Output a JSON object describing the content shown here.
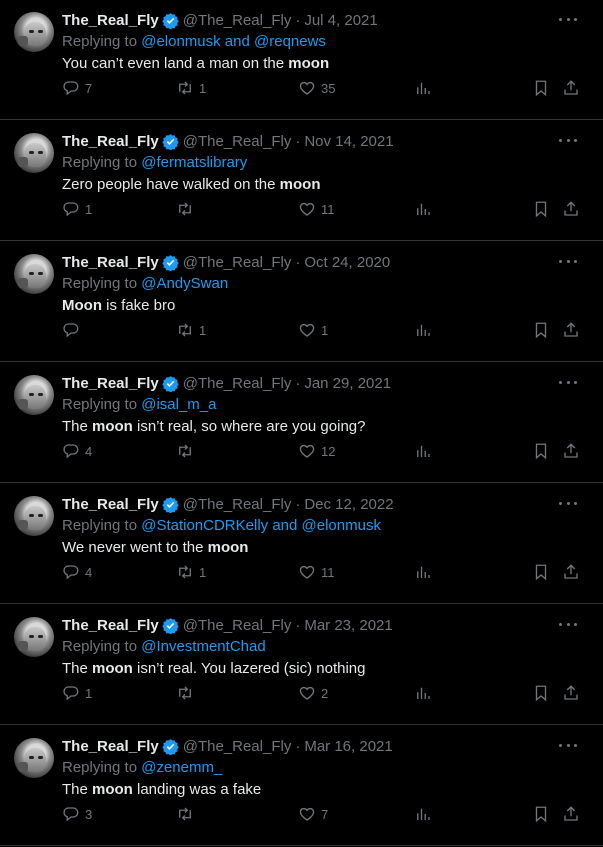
{
  "tweets": [
    {
      "name": "The_Real_Fly",
      "handle": "@The_Real_Fly",
      "date": "Jul 4, 2021",
      "replying_prefix": "Replying to ",
      "replying_to": "@elonmusk and @reqnews",
      "text_before": "You can’t even land a man on the ",
      "bold": "moon",
      "text_after": "",
      "replies": "7",
      "retweets": "1",
      "likes": "35"
    },
    {
      "name": "The_Real_Fly",
      "handle": "@The_Real_Fly",
      "date": "Nov 14, 2021",
      "replying_prefix": "Replying to ",
      "replying_to": "@fermatslibrary",
      "text_before": "Zero people have walked on the ",
      "bold": "moon",
      "text_after": "",
      "replies": "1",
      "retweets": "",
      "likes": "11"
    },
    {
      "name": "The_Real_Fly",
      "handle": "@The_Real_Fly",
      "date": "Oct 24, 2020",
      "replying_prefix": "Replying to ",
      "replying_to": "@AndySwan",
      "text_before": "",
      "bold": "Moon",
      "text_after": " is fake bro",
      "replies": "",
      "retweets": "1",
      "likes": "1"
    },
    {
      "name": "The_Real_Fly",
      "handle": "@The_Real_Fly",
      "date": "Jan 29, 2021",
      "replying_prefix": "Replying to ",
      "replying_to": "@isal_m_a",
      "text_before": "The ",
      "bold": "moon",
      "text_after": " isn’t real, so where are you going?",
      "replies": "4",
      "retweets": "",
      "likes": "12"
    },
    {
      "name": "The_Real_Fly",
      "handle": "@The_Real_Fly",
      "date": "Dec 12, 2022",
      "replying_prefix": "Replying to ",
      "replying_to": "@StationCDRKelly and @elonmusk",
      "text_before": "We never went to the ",
      "bold": "moon",
      "text_after": "",
      "replies": "4",
      "retweets": "1",
      "likes": "11"
    },
    {
      "name": "The_Real_Fly",
      "handle": "@The_Real_Fly",
      "date": "Mar 23, 2021",
      "replying_prefix": "Replying to ",
      "replying_to": "@InvestmentChad",
      "text_before": "The ",
      "bold": "moon",
      "text_after": " isn’t real. You lazered (sic) nothing",
      "replies": "1",
      "retweets": "",
      "likes": "2"
    },
    {
      "name": "The_Real_Fly",
      "handle": "@The_Real_Fly",
      "date": "Mar 16, 2021",
      "replying_prefix": "Replying to ",
      "replying_to": "@zenemm_",
      "text_before": "The ",
      "bold": "moon",
      "text_after": " landing was a fake",
      "replies": "3",
      "retweets": "",
      "likes": "7"
    }
  ],
  "dot": "·",
  "colors": {
    "background": "#000000",
    "text": "#e7e9ea",
    "muted": "#71767b",
    "link": "#1d9bf0",
    "verified": "#1d9bf0",
    "divider": "#2f3336"
  },
  "icons": {
    "verified": "verified-badge-icon",
    "reply": "reply-icon",
    "retweet": "retweet-icon",
    "like": "heart-icon",
    "views": "views-icon",
    "bookmark": "bookmark-icon",
    "share": "share-icon",
    "more": "more-icon"
  }
}
